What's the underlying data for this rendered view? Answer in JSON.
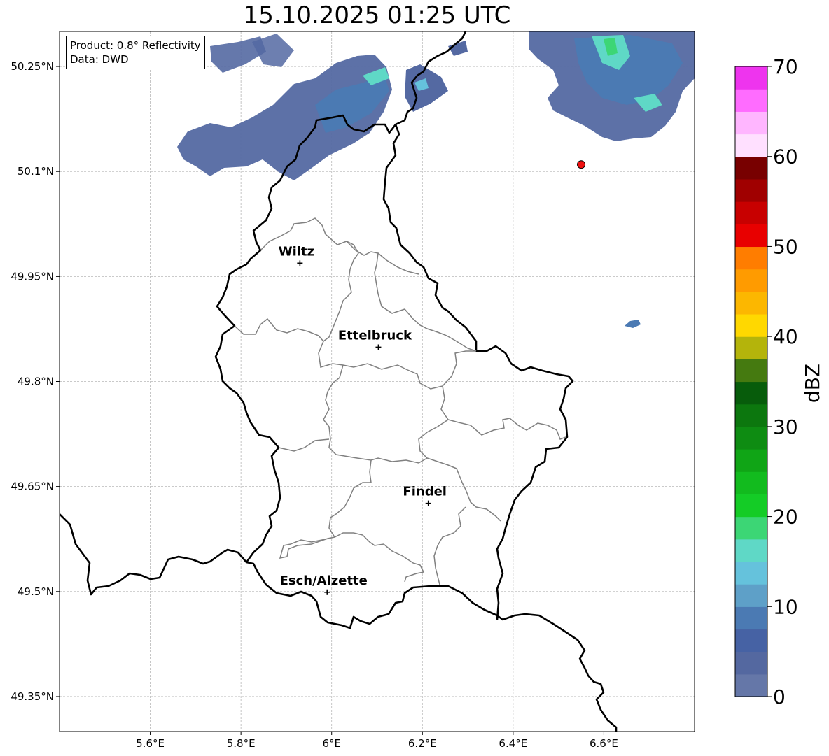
{
  "title": "15.10.2025 01:25 UTC",
  "info": {
    "product": "Product: 0.8° Reflectivity",
    "data_source": "Data: DWD"
  },
  "extent": {
    "lon_min": 5.4,
    "lon_max": 6.8,
    "lat_min": 49.3,
    "lat_max": 50.3
  },
  "axes": {
    "lon_ticks": [
      5.6,
      5.8,
      6.0,
      6.2,
      6.4,
      6.6
    ],
    "lon_tick_labels": [
      "5.6°E",
      "5.8°E",
      "6°E",
      "6.2°E",
      "6.4°E",
      "6.6°E"
    ],
    "lat_ticks": [
      50.25,
      50.1,
      49.95,
      49.8,
      49.65,
      49.5,
      49.35
    ],
    "lat_tick_labels": [
      "50.25°N",
      "50.1°N",
      "49.95°N",
      "49.8°N",
      "49.65°N",
      "49.5°N",
      "49.35°N"
    ],
    "grid": true
  },
  "cities": [
    {
      "name": "Wiltz",
      "lon": 5.93,
      "lat": 49.969
    },
    {
      "name": "Ettelbruck",
      "lon": 6.103,
      "lat": 49.849
    },
    {
      "name": "Findel",
      "lon": 6.213,
      "lat": 49.626
    },
    {
      "name": "Esch/Alzette",
      "lon": 5.99,
      "lat": 49.499
    }
  ],
  "marker": {
    "lon": 6.55,
    "lat": 50.11,
    "color": "#ee1111"
  },
  "colorbar": {
    "label": "dBZ",
    "min": 0,
    "max": 70,
    "step": 2.5,
    "tick_values": [
      0,
      10,
      20,
      30,
      40,
      50,
      60,
      70
    ],
    "tick_labels": [
      "0",
      "10",
      "20",
      "30",
      "40",
      "50",
      "60",
      "70"
    ],
    "colors": [
      "#6577a8",
      "#5468a0",
      "#4662a4",
      "#4b7ab3",
      "#5ea0c8",
      "#65c2dc",
      "#5fd8c6",
      "#3cd675",
      "#14cc26",
      "#12bb1e",
      "#10a516",
      "#0e8c12",
      "#0c770e",
      "#075c0b",
      "#457a10",
      "#b4b40b",
      "#ffd800",
      "#fcb700",
      "#ff9b00",
      "#ff7d00",
      "#e80000",
      "#c80000",
      "#a00000",
      "#780000",
      "#ffe0ff",
      "#ffb6ff",
      "#ff6cff",
      "#ee34ee"
    ]
  }
}
